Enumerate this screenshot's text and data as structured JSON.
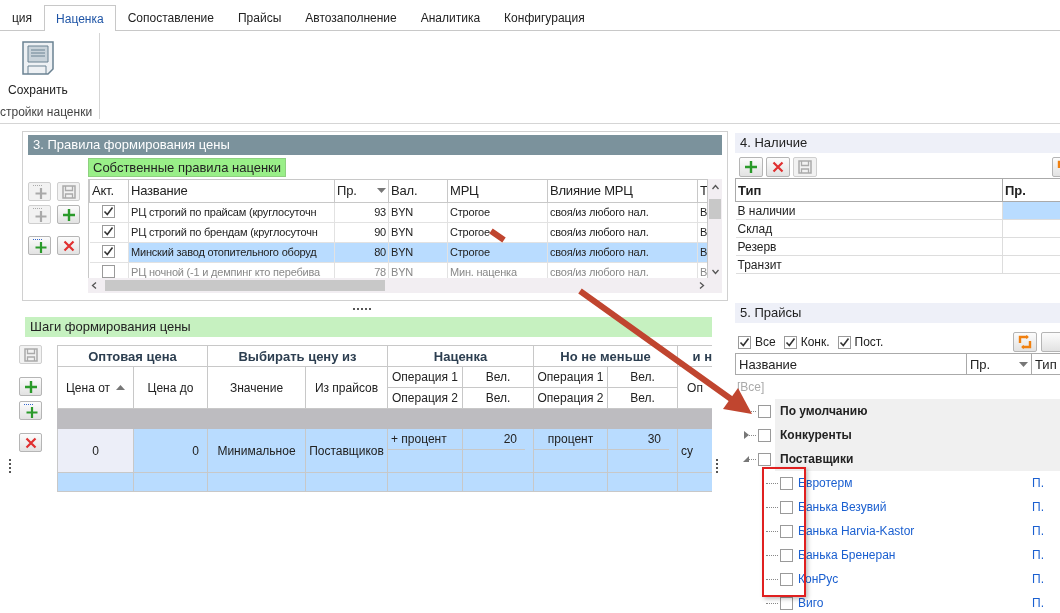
{
  "tabs": [
    {
      "label": "ция",
      "selected": false
    },
    {
      "label": "Наценка",
      "selected": true
    },
    {
      "label": "Сопоставление",
      "selected": false
    },
    {
      "label": "Прайсы",
      "selected": false
    },
    {
      "label": "Автозаполнение",
      "selected": false
    },
    {
      "label": "Аналитика",
      "selected": false
    },
    {
      "label": "Конфигурация",
      "selected": false
    }
  ],
  "ribbon": {
    "save_button": "Сохранить",
    "group_label": "стройки наценки"
  },
  "rules_panel": {
    "title": "3. Правила формирования цены",
    "subtitle": "Собственные правила наценки",
    "toolbar": [
      {
        "kind": "insert",
        "disabled": true
      },
      {
        "kind": "save",
        "disabled": true
      },
      {
        "kind": "insert",
        "disabled": true
      },
      {
        "kind": "add",
        "disabled": false
      },
      {
        "kind": "insert",
        "disabled": false
      },
      {
        "kind": "delete",
        "disabled": false
      }
    ],
    "columns": [
      {
        "label": "Акт."
      },
      {
        "label": "Название"
      },
      {
        "label": "Пр.",
        "sort_descending": true
      },
      {
        "label": "Вал."
      },
      {
        "label": "МРЦ"
      },
      {
        "label": "Влияние МРЦ"
      },
      {
        "label": "Т"
      }
    ],
    "rows": [
      {
        "active": true,
        "selected": false,
        "name": "РЦ строгий по прайсам (круглосуточн",
        "priority": "93",
        "currency": "BYN",
        "mrc": "Строгое",
        "mrc_effect": "своя/из любого нал.",
        "column_7": "В"
      },
      {
        "active": true,
        "selected": false,
        "name": "РЦ строгий по брендам (круглосуточн",
        "priority": "90",
        "currency": "BYN",
        "mrc": "Строгое",
        "mrc_effect": "своя/из любого нал.",
        "column_7": "В"
      },
      {
        "active": true,
        "selected": true,
        "name": "Минский завод отопительного оборуд",
        "priority": "80",
        "currency": "BYN",
        "mrc": "Строгое",
        "mrc_effect": "своя/из любого нал.",
        "column_7": "В"
      },
      {
        "active": false,
        "selected": false,
        "name": "РЦ ночной (-1 и демпинг кто перебива",
        "priority": "78",
        "currency": "BYN",
        "mrc": "Мин. наценка",
        "mrc_effect": "своя/из любого нал.",
        "column_7": "В"
      }
    ]
  },
  "steps_panel": {
    "title": "Шаги формирования цены",
    "toolbar": [
      {
        "kind": "save",
        "disabled": true
      },
      {
        "kind": "add",
        "disabled": false
      },
      {
        "kind": "insert",
        "disabled": false
      },
      {
        "kind": "delete",
        "disabled": false
      }
    ],
    "header_groups": [
      {
        "label": "Оптовая цена",
        "kind": "plain",
        "columns": [
          {
            "label": "Цена от",
            "sort_ascending": true
          },
          {
            "label": "Цена до"
          }
        ]
      },
      {
        "label": "Выбирать цену из",
        "kind": "plain",
        "columns": [
          {
            "label": "Значение"
          },
          {
            "label": "Из прайсов"
          }
        ]
      },
      {
        "label": "Наценка",
        "kind": "ops",
        "rows": [
          [
            {
              "label": "Операция 1"
            },
            {
              "label": "Вел."
            }
          ],
          [
            {
              "label": "Операция 2"
            },
            {
              "label": "Вел."
            }
          ]
        ]
      },
      {
        "label": "Но не меньше",
        "kind": "ops",
        "rows": [
          [
            {
              "label": "Операция 1"
            },
            {
              "label": "Вел."
            }
          ],
          [
            {
              "label": "Операция 2"
            },
            {
              "label": "Вел."
            }
          ]
        ]
      },
      {
        "label": "и н",
        "kind": "plain",
        "columns": [
          {
            "label": "Оп"
          }
        ]
      }
    ],
    "rows": [
      {
        "kind": "group"
      },
      {
        "kind": "data",
        "selected": true,
        "price_from": "0",
        "price_to": "0",
        "value": "Минимальное",
        "source": "Поставщиков",
        "markup_op1": "+ процент",
        "markup_val1": "20",
        "min_op1": "процент",
        "min_val1": "30",
        "last": "су"
      },
      {
        "kind": "new"
      }
    ]
  },
  "stock_panel": {
    "title": "4. Наличие",
    "toolbar": [
      {
        "kind": "add",
        "disabled": false
      },
      {
        "kind": "delete",
        "disabled": false
      },
      {
        "kind": "save",
        "disabled": true
      },
      {
        "kind": "refresh",
        "disabled": false
      }
    ],
    "columns": [
      "Тип",
      "Пр."
    ],
    "rows": [
      {
        "label": "В наличии",
        "selected": true
      },
      {
        "label": "Склад",
        "selected": false
      },
      {
        "label": "Резерв",
        "selected": false
      },
      {
        "label": "Транзит",
        "selected": false
      }
    ]
  },
  "prices_panel": {
    "title": "5. Прайсы",
    "filters": [
      {
        "label": "Все",
        "checked": true
      },
      {
        "label": "Конк.",
        "checked": true
      },
      {
        "label": "Пост.",
        "checked": true
      }
    ],
    "columns": [
      {
        "label": "Название"
      },
      {
        "label": "Пр.",
        "sort_descending": true
      },
      {
        "label": "Тип"
      }
    ],
    "filter_row": "[Все]",
    "tree": [
      {
        "label": "По умолчанию",
        "checked": false
      },
      {
        "label": "Конкуренты",
        "checked": false,
        "expanded": false
      },
      {
        "label": "Поставщики",
        "checked": false,
        "expanded": true,
        "children": [
          {
            "label": "Евротерм",
            "checked": false,
            "type": "П."
          },
          {
            "label": "Банька Везувий",
            "checked": false,
            "type": "П."
          },
          {
            "label": "Банька Harvia-Kastor",
            "checked": false,
            "type": "П."
          },
          {
            "label": "Банька Бренеран",
            "checked": false,
            "type": "П."
          },
          {
            "label": "КонРус",
            "checked": false,
            "type": "П."
          },
          {
            "label": "Виго",
            "checked": false,
            "type": "П."
          }
        ]
      }
    ]
  }
}
